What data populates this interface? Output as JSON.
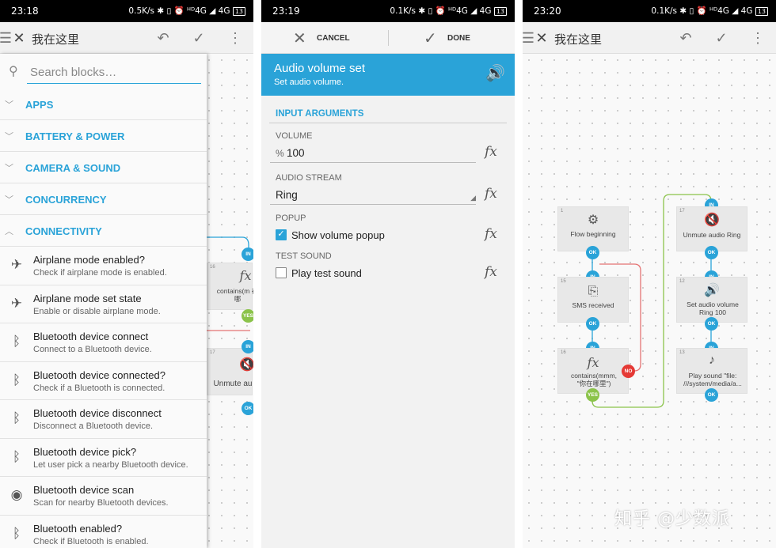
{
  "panel1": {
    "time": "23:18",
    "status_right": "0.5K/s ✱ ▯ ⏰ ᴴᴰ4G ◢ 4G",
    "battery": "13",
    "title": "我在这里",
    "search_placeholder": "Search blocks…",
    "categories": [
      {
        "label": "APPS",
        "expanded": false
      },
      {
        "label": "BATTERY & POWER",
        "expanded": false
      },
      {
        "label": "CAMERA & SOUND",
        "expanded": false
      },
      {
        "label": "CONCURRENCY",
        "expanded": false
      },
      {
        "label": "CONNECTIVITY",
        "expanded": true
      }
    ],
    "blocks": [
      {
        "title": "Airplane mode enabled?",
        "desc": "Check if airplane mode is enabled.",
        "icon": "airplane-icon"
      },
      {
        "title": "Airplane mode set state",
        "desc": "Enable or disable airplane mode.",
        "icon": "airplane-icon"
      },
      {
        "title": "Bluetooth device connect",
        "desc": "Connect to a Bluetooth device.",
        "icon": "bluetooth-connect-icon"
      },
      {
        "title": "Bluetooth device connected?",
        "desc": "Check if a Bluetooth is connected.",
        "icon": "bluetooth-connected-icon"
      },
      {
        "title": "Bluetooth device disconnect",
        "desc": "Disconnect a Bluetooth device.",
        "icon": "bluetooth-disconnect-icon"
      },
      {
        "title": "Bluetooth device pick?",
        "desc": "Let user pick a nearby Bluetooth device.",
        "icon": "bluetooth-pick-icon"
      },
      {
        "title": "Bluetooth device scan",
        "desc": "Scan for nearby Bluetooth devices.",
        "icon": "bluetooth-scan-icon"
      },
      {
        "title": "Bluetooth enabled?",
        "desc": "Check if Bluetooth is enabled.",
        "icon": "bluetooth-icon"
      }
    ],
    "bg_nodes": {
      "n16_num": "16",
      "n16_text": "contains(m 在哪",
      "n17_num": "17",
      "n17_text": "Unmute au",
      "in": "IN",
      "yes": "YES",
      "ok": "OK"
    }
  },
  "panel2": {
    "time": "23:19",
    "status_right": "0.1K/s ✱ ▯ ⏰ ᴴᴰ4G ◢ 4G",
    "battery": "13",
    "cancel": "CANCEL",
    "done": "DONE",
    "header_title": "Audio volume set",
    "header_sub": "Set audio volume.",
    "section": "INPUT ARGUMENTS",
    "volume_label": "VOLUME",
    "volume_prefix": "%",
    "volume_value": "100",
    "stream_label": "AUDIO STREAM",
    "stream_value": "Ring",
    "popup_label": "POPUP",
    "popup_text": "Show volume popup",
    "popup_checked": true,
    "test_label": "TEST SOUND",
    "test_text": "Play test sound",
    "test_checked": false,
    "fx": "fx"
  },
  "panel3": {
    "time": "23:20",
    "status_right": "0.1K/s ✱ ▯ ⏰ ᴴᴰ4G ◢ 4G",
    "battery": "13",
    "title": "我在这里",
    "nodes": {
      "n1": {
        "num": "1",
        "text": "Flow beginning"
      },
      "n15": {
        "num": "15",
        "text": "SMS received"
      },
      "n16": {
        "num": "16",
        "text": "contains(mmm, \"你在哪里\")"
      },
      "n17": {
        "num": "17",
        "text": "Unmute audio Ring"
      },
      "n12": {
        "num": "12",
        "text": "Set audio volume Ring 100"
      },
      "n13": {
        "num": "13",
        "text": "Play sound \"file: ///system/media/a..."
      }
    },
    "port_in": "IN",
    "port_ok": "OK",
    "port_yes": "YES",
    "port_no": "NO"
  },
  "watermark": "知乎 @少数派"
}
